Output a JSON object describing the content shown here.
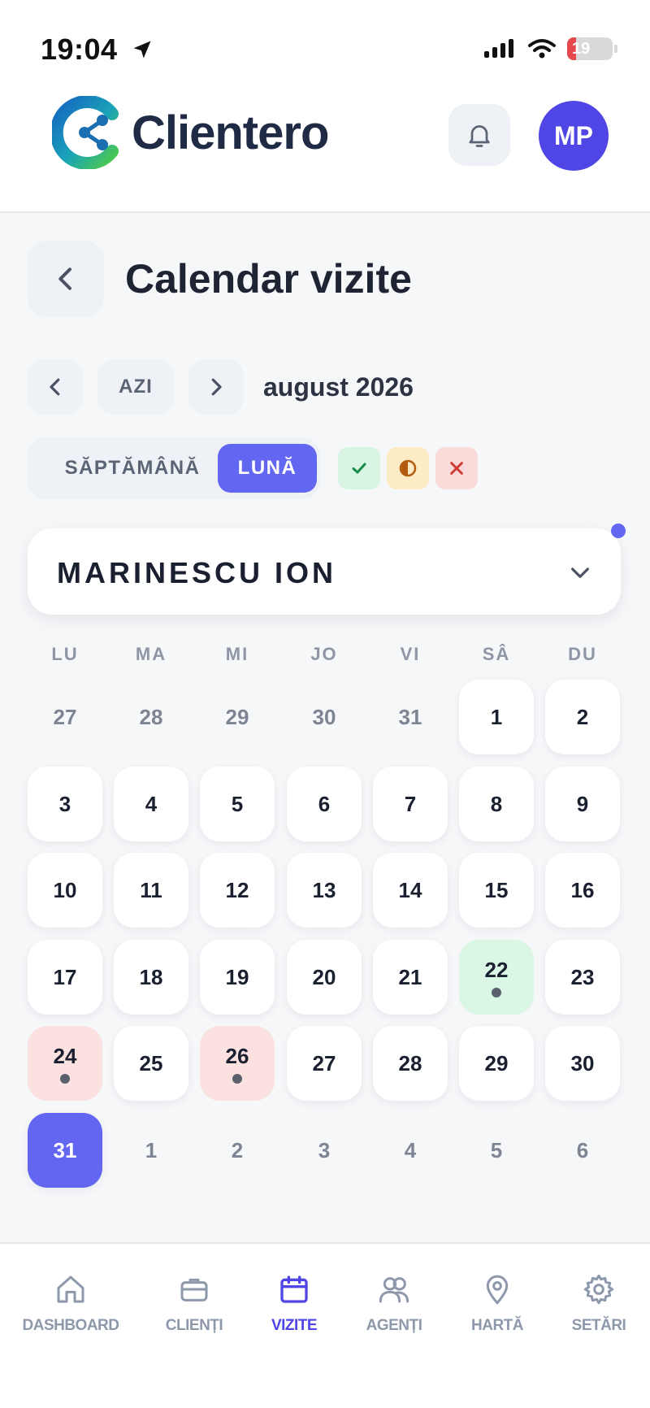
{
  "status_bar": {
    "time": "19:04",
    "battery": "19",
    "battery_level": 0.19
  },
  "header": {
    "logo_text": "Clientero",
    "avatar_initials": "MP",
    "icons": [
      "bell-icon"
    ]
  },
  "page": {
    "title": "Calendar vizite"
  },
  "month_nav": {
    "today_label": "AZI",
    "month_label": "august 2026"
  },
  "view_toggle": {
    "week_label": "SĂPTĂMÂNĂ",
    "month_label": "LUNĂ",
    "selected": "LUNĂ"
  },
  "filters": [
    {
      "name": "completed",
      "glyph": "✓",
      "color": "#1a8a4a"
    },
    {
      "name": "partial",
      "glyph": "◑",
      "color": "#b35c10"
    },
    {
      "name": "cancelled",
      "glyph": "✕",
      "color": "#d33b3b"
    }
  ],
  "agent": {
    "name": "MARINESCU ION"
  },
  "calendar": {
    "weekdays": [
      "LU",
      "MA",
      "MI",
      "JO",
      "VI",
      "SÂ",
      "DU"
    ],
    "weeks": [
      [
        {
          "d": "27",
          "cur": false
        },
        {
          "d": "28",
          "cur": false
        },
        {
          "d": "29",
          "cur": false
        },
        {
          "d": "30",
          "cur": false
        },
        {
          "d": "31",
          "cur": false
        },
        {
          "d": "1",
          "cur": true
        },
        {
          "d": "2",
          "cur": true
        }
      ],
      [
        {
          "d": "3",
          "cur": true
        },
        {
          "d": "4",
          "cur": true
        },
        {
          "d": "5",
          "cur": true
        },
        {
          "d": "6",
          "cur": true
        },
        {
          "d": "7",
          "cur": true
        },
        {
          "d": "8",
          "cur": true
        },
        {
          "d": "9",
          "cur": true
        }
      ],
      [
        {
          "d": "10",
          "cur": true
        },
        {
          "d": "11",
          "cur": true
        },
        {
          "d": "12",
          "cur": true
        },
        {
          "d": "13",
          "cur": true
        },
        {
          "d": "14",
          "cur": true
        },
        {
          "d": "15",
          "cur": true
        },
        {
          "d": "16",
          "cur": true
        }
      ],
      [
        {
          "d": "17",
          "cur": true
        },
        {
          "d": "18",
          "cur": true
        },
        {
          "d": "19",
          "cur": true
        },
        {
          "d": "20",
          "cur": true
        },
        {
          "d": "21",
          "cur": true
        },
        {
          "d": "22",
          "cur": true,
          "status": "green",
          "dot": true
        },
        {
          "d": "23",
          "cur": true
        }
      ],
      [
        {
          "d": "24",
          "cur": true,
          "status": "red",
          "dot": true
        },
        {
          "d": "25",
          "cur": true
        },
        {
          "d": "26",
          "cur": true,
          "status": "red",
          "dot": true
        },
        {
          "d": "27",
          "cur": true
        },
        {
          "d": "28",
          "cur": true
        },
        {
          "d": "29",
          "cur": true
        },
        {
          "d": "30",
          "cur": true
        }
      ],
      [
        {
          "d": "31",
          "cur": true,
          "today": true
        },
        {
          "d": "1",
          "cur": false
        },
        {
          "d": "2",
          "cur": false
        },
        {
          "d": "3",
          "cur": false
        },
        {
          "d": "4",
          "cur": false
        },
        {
          "d": "5",
          "cur": false
        },
        {
          "d": "6",
          "cur": false
        }
      ]
    ]
  },
  "bottom_nav": [
    {
      "label": "DASHBOARD",
      "icon": "home-icon",
      "active": false
    },
    {
      "label": "CLIENȚI",
      "icon": "briefcase-icon",
      "active": false
    },
    {
      "label": "VIZITE",
      "icon": "calendar-icon",
      "active": true
    },
    {
      "label": "AGENȚI",
      "icon": "users-icon",
      "active": false
    },
    {
      "label": "HARTĂ",
      "icon": "map-pin-icon",
      "active": false
    },
    {
      "label": "SETĂRI",
      "icon": "gear-icon",
      "active": false
    }
  ],
  "colors": {
    "accent": "#6366f1",
    "visit_done": "#daf6e4",
    "visit_cancelled": "#fbe1df"
  }
}
